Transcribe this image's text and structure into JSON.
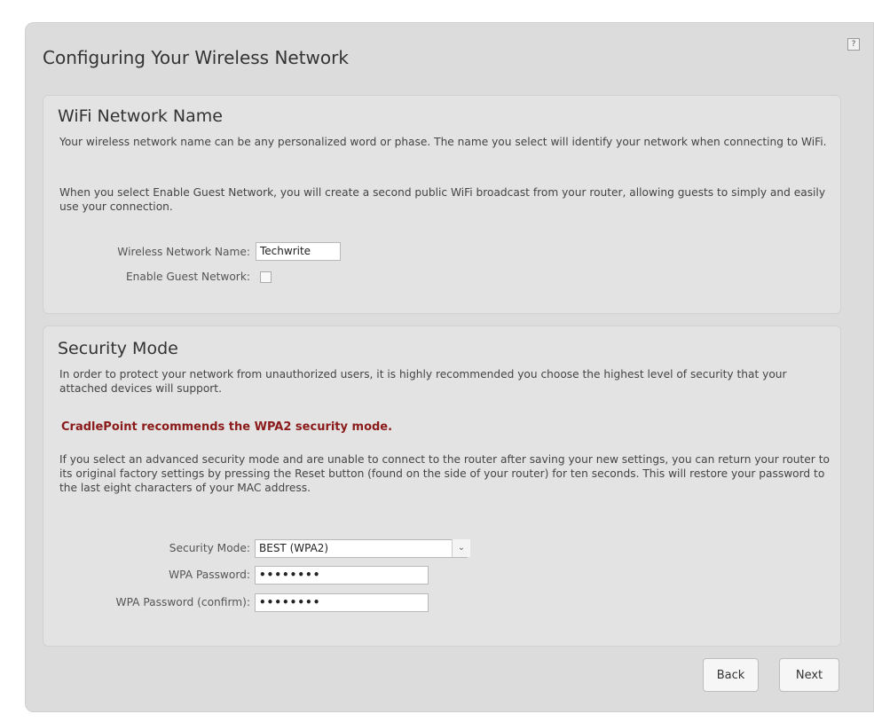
{
  "page": {
    "title": "Configuring Your Wireless Network",
    "help_label": "?"
  },
  "wifi_section": {
    "title": "WiFi Network Name",
    "paragraph1": "Your wireless network name can be any personalized word or phase. The name you select will identify your network when connecting to WiFi.",
    "paragraph2": "When you select Enable Guest Network, you will create a second public WiFi broadcast from your router, allowing guests to simply and easily use your connection.",
    "network_name_label": "Wireless Network Name:",
    "network_name_value": "Techwrite",
    "guest_network_label": "Enable Guest Network:",
    "guest_network_checked": false
  },
  "security_section": {
    "title": "Security Mode",
    "paragraph1": "In order to protect your network from unauthorized users, it is highly recommended you choose the highest level of security that your attached devices will support.",
    "warning": "CradlePoint recommends the WPA2 security mode.",
    "paragraph2": "If you select an advanced security mode and are unable to connect to the router after saving your new settings, you can return your router to its original factory settings by pressing the Reset button (found on the side of your router) for ten seconds. This will restore your password to the last eight characters of your MAC address.",
    "security_mode_label": "Security Mode:",
    "security_mode_value": "BEST (WPA2)",
    "password_label": "WPA Password:",
    "password_value": "••••••••",
    "confirm_label": "WPA Password (confirm):",
    "confirm_value": "••••••••",
    "warning_color": "#8b1a1a"
  },
  "buttons": {
    "back": "Back",
    "next": "Next"
  }
}
